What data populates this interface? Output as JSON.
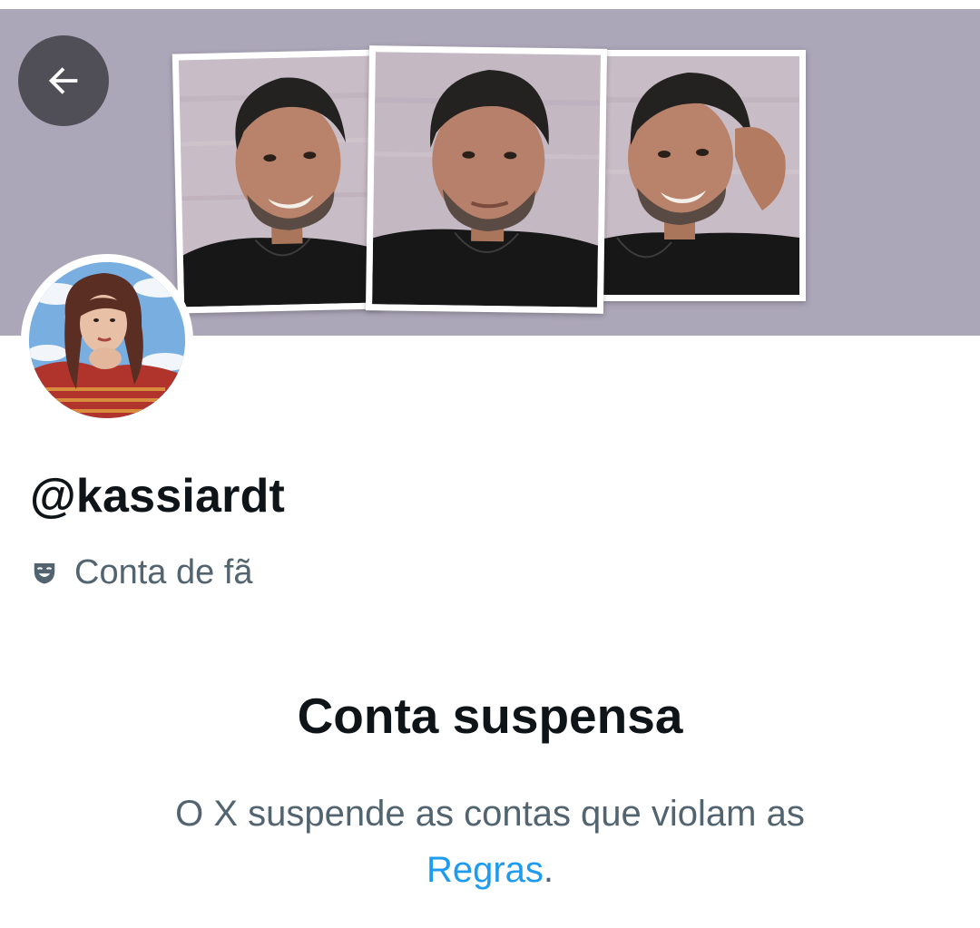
{
  "header": {
    "back_icon": "arrow-left-icon"
  },
  "profile": {
    "handle": "@kassiardt",
    "category_icon": "theater-mask-icon",
    "category_label": "Conta de fã"
  },
  "notice": {
    "title": "Conta suspensa",
    "description": "O X suspende as contas que violam as",
    "link_label": "Regras",
    "trailing": "."
  },
  "colors": {
    "banner": "#aba6b8",
    "text_primary": "#0f1419",
    "text_secondary": "#536471",
    "link": "#1d9bf0"
  }
}
